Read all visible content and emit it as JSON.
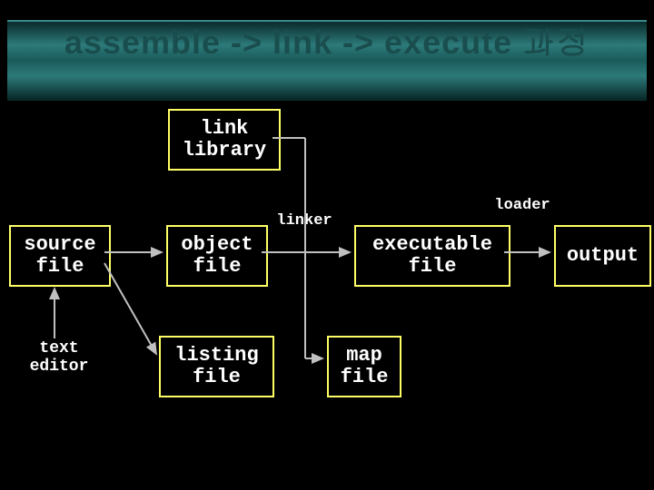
{
  "title": "assemble -> link -> execute 과정",
  "boxes": {
    "link_library": "link\nlibrary",
    "source_file": "source\nfile",
    "object_file": "object\nfile",
    "listing_file": "listing\nfile",
    "executable_file": "executable\nfile",
    "map_file": "map\nfile",
    "output": "output"
  },
  "labels": {
    "text_editor": "text\neditor",
    "linker": "linker",
    "loader": "loader"
  }
}
